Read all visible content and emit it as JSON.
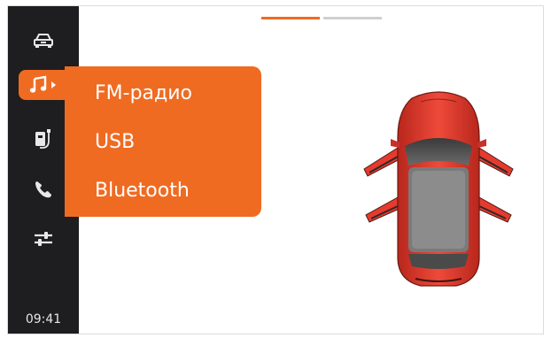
{
  "sidebar": {
    "items": [
      {
        "icon": "car-icon"
      },
      {
        "icon": "music-note-icon",
        "active": true
      },
      {
        "icon": "usb-device-icon"
      },
      {
        "icon": "phone-icon"
      },
      {
        "icon": "sliders-icon"
      }
    ],
    "time": "09:41"
  },
  "pager": {
    "pages": 2,
    "active_page": 1
  },
  "source_menu": {
    "items": [
      {
        "label": "FM-радио"
      },
      {
        "label": "USB"
      },
      {
        "label": "Bluetooth"
      }
    ]
  },
  "car_diagram": {
    "icon": "car-open-doors-icon",
    "doors_open": [
      "front-left",
      "front-right",
      "rear-left",
      "rear-right"
    ]
  },
  "colors": {
    "accent": "#ef6b22",
    "sidebar": "#1e1e20",
    "car_body": "#e63a2e"
  }
}
